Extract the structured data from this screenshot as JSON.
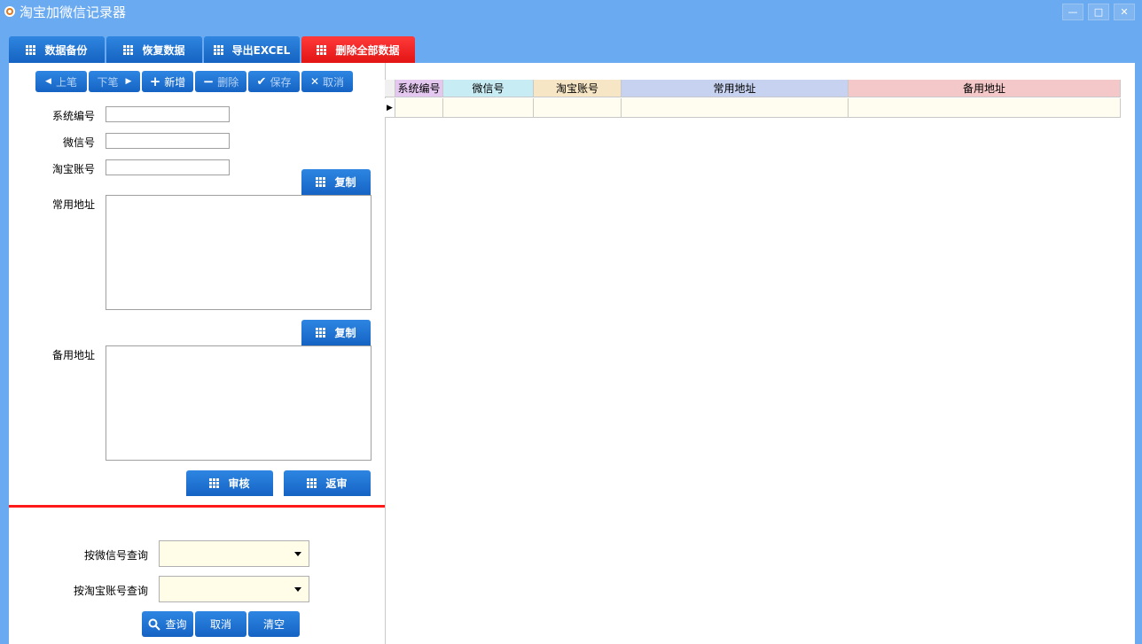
{
  "window": {
    "title": "淘宝加微信记录器",
    "minimize_glyph": "—",
    "maximize_glyph": "□",
    "close_glyph": "✕"
  },
  "tabs": [
    {
      "label": "数据备份"
    },
    {
      "label": "恢复数据"
    },
    {
      "label": "导出EXCEL"
    },
    {
      "label": "删除全部数据"
    }
  ],
  "nav": {
    "prev": "上笔",
    "next": "下笔",
    "add": "新增",
    "delete": "删除",
    "save": "保存",
    "cancel": "取消"
  },
  "form": {
    "system_id_label": "系统编号",
    "system_id_value": "",
    "wechat_label": "微信号",
    "wechat_value": "",
    "taobao_label": "淘宝账号",
    "taobao_value": "",
    "address_label": "常用地址",
    "address_value": "",
    "backup_address_label": "备用地址",
    "backup_address_value": "",
    "copy_label": "复制",
    "approve_label": "审核",
    "unapprove_label": "返审"
  },
  "query": {
    "by_wechat_label": "按微信号查询",
    "by_wechat_value": "",
    "by_taobao_label": "按淘宝账号查询",
    "by_taobao_value": "",
    "search_label": "查询",
    "cancel_label": "取消",
    "clear_label": "清空"
  },
  "table": {
    "columns": [
      {
        "label": "系统编号",
        "color": "#e4c8f0"
      },
      {
        "label": "微信号",
        "color": "#c8ecf4"
      },
      {
        "label": "淘宝账号",
        "color": "#f6e6c6"
      },
      {
        "label": "常用地址",
        "color": "#c6d2f0"
      },
      {
        "label": "备用地址",
        "color": "#f4c8c8"
      }
    ],
    "rows": [
      [
        "",
        "",
        "",
        "",
        ""
      ]
    ]
  },
  "colors": {
    "accent": "#1a6fd0",
    "danger": "#e31414",
    "background": "#6aaaf0"
  }
}
